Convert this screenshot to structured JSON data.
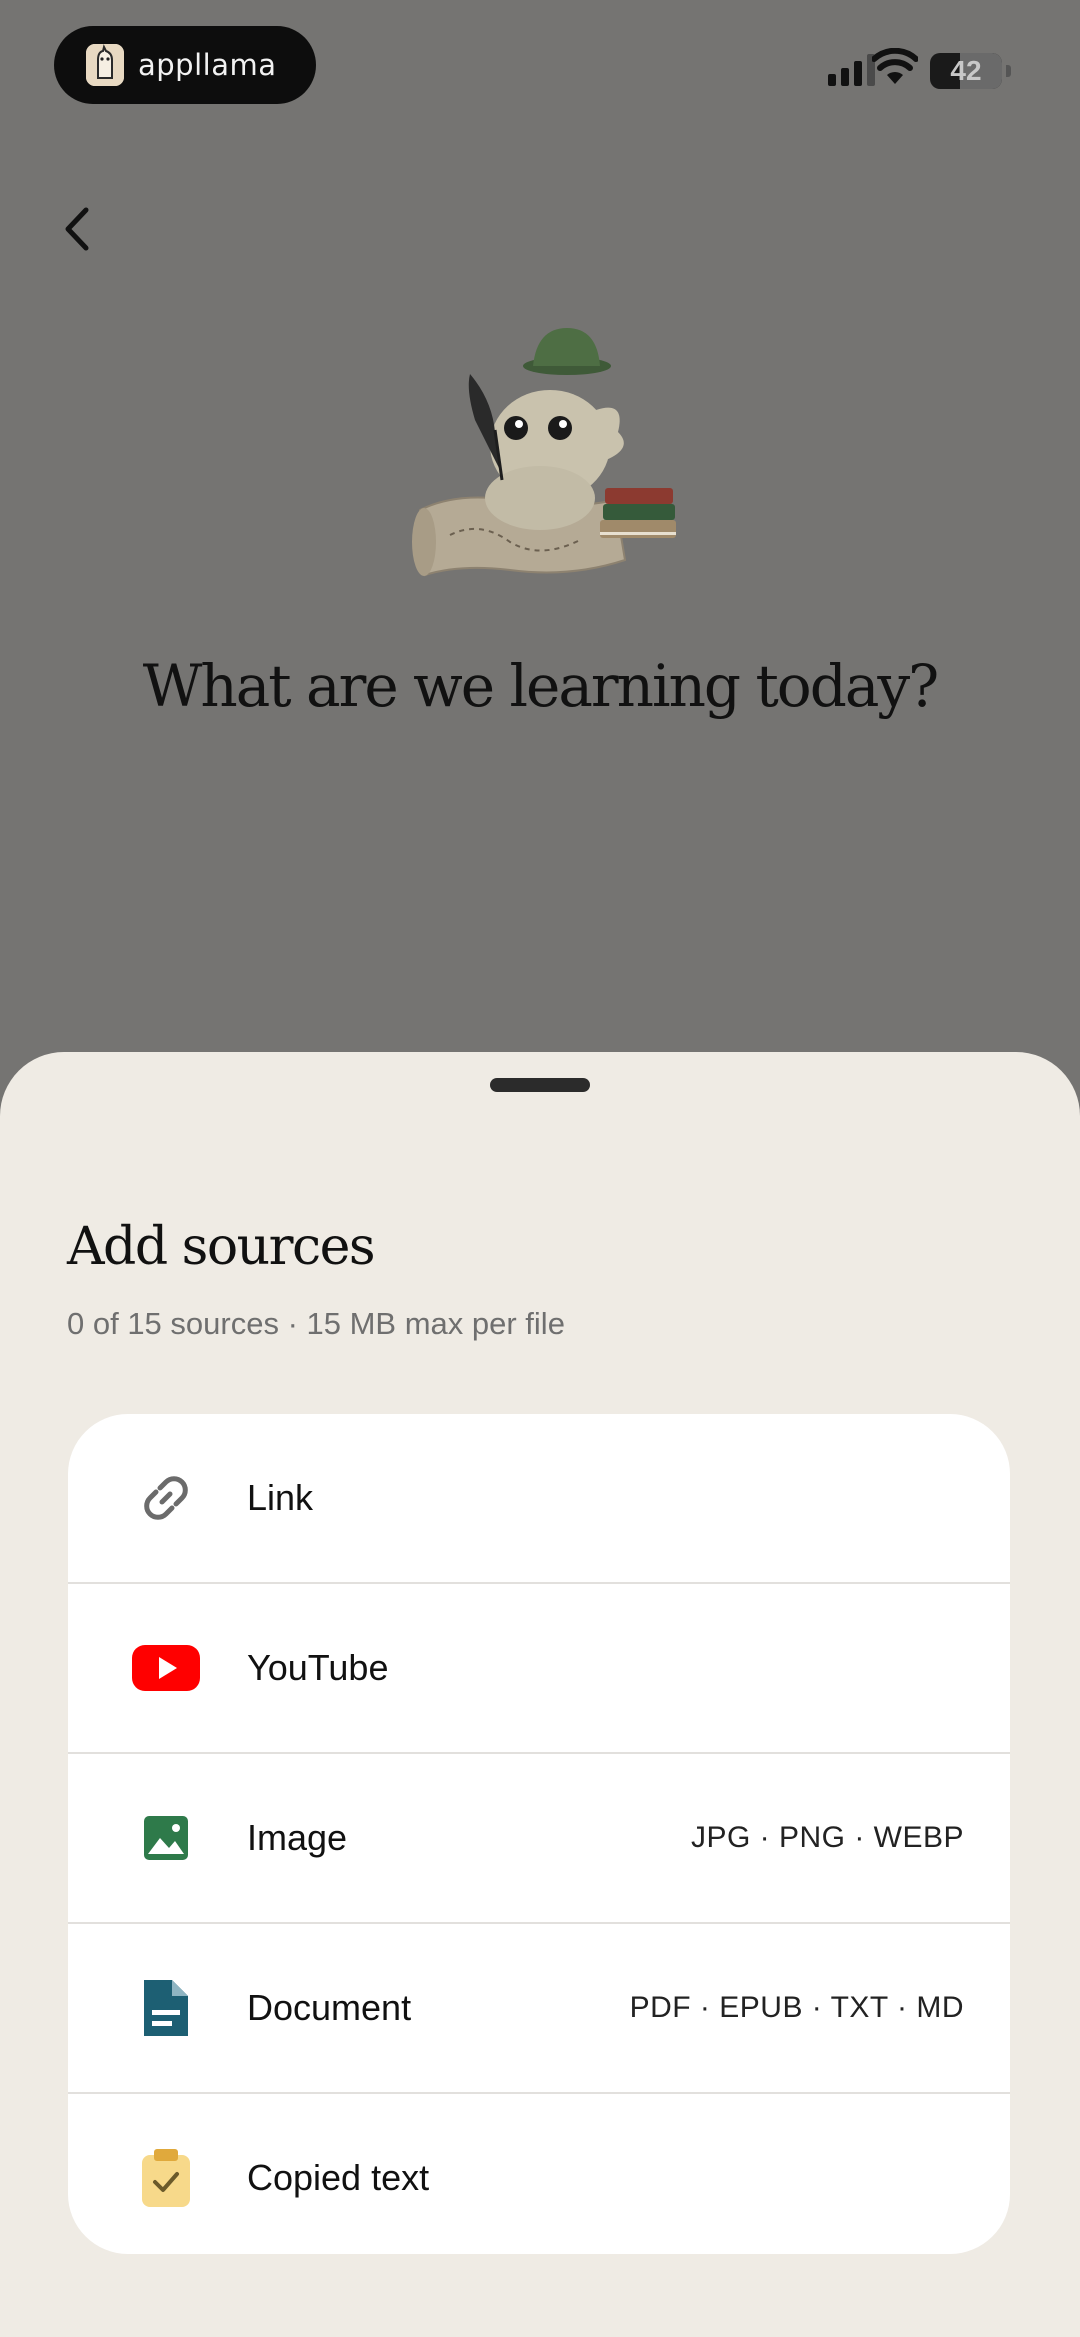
{
  "status_bar": {
    "app_name": "appllama",
    "battery": "42"
  },
  "hero": {
    "title": "What are we learning today?"
  },
  "sheet": {
    "title": "Add sources",
    "subtitle": "0 of 15 sources · 15 MB max per file",
    "options": [
      {
        "label": "Link",
        "hint": "",
        "icon": "link-icon"
      },
      {
        "label": "YouTube",
        "hint": "",
        "icon": "youtube-icon"
      },
      {
        "label": "Image",
        "hint": "JPG · PNG · WEBP",
        "icon": "image-icon"
      },
      {
        "label": "Document",
        "hint": "PDF · EPUB · TXT · MD",
        "icon": "document-icon"
      },
      {
        "label": "Copied text",
        "hint": "",
        "icon": "clipboard-icon"
      }
    ]
  },
  "colors": {
    "overlay": "#757472",
    "sheet_bg": "#efebe4",
    "youtube_red": "#ff0000",
    "image_green": "#2e7a4a",
    "document_teal": "#1d5f73",
    "clipboard_yellow": "#f7d98a"
  }
}
